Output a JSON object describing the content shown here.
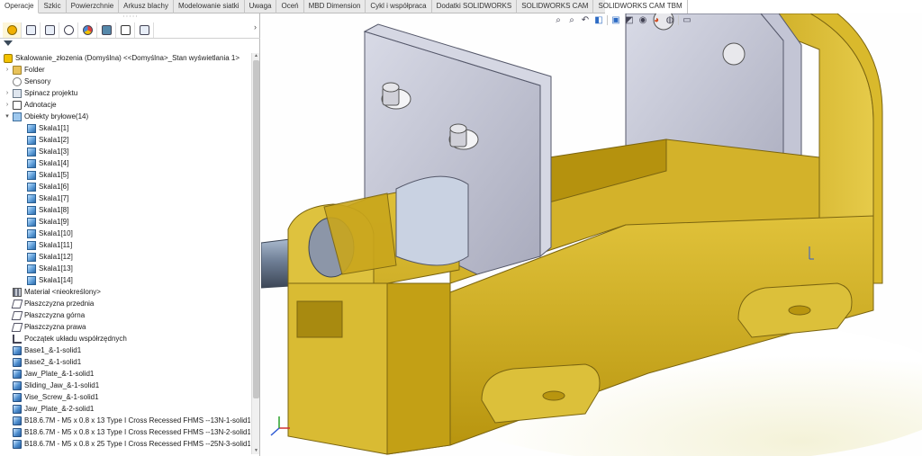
{
  "tabs": [
    "Operacje",
    "Szkic",
    "Powierzchnie",
    "Arkusz blachy",
    "Modelowanie siatki",
    "Uwaga",
    "Oceń",
    "MBD Dimension",
    "Cykl i współpraca",
    "Dodatki SOLIDWORKS",
    "SOLIDWORKS CAM",
    "SOLIDWORKS CAM TBM"
  ],
  "active_tab": "Operacje",
  "panel_icons": [
    "feature-manager-icon",
    "property-manager-icon",
    "configuration-manager-icon",
    "dimxpert-icon",
    "display-manager-icon",
    "cam-feature-tree-icon",
    "cam-operation-tree-icon",
    "cam-tool-tree-icon"
  ],
  "tree": {
    "root": "Skalowanie_złozenia (Domyślna) <<Domyślna>_Stan wyświetlania 1>",
    "items": [
      {
        "label": "Folder",
        "icon": "folder-icon",
        "expandable": true
      },
      {
        "label": "Sensory",
        "icon": "sensor-icon",
        "expandable": false
      },
      {
        "label": "Spinacz projektu",
        "icon": "design-binder-icon",
        "expandable": true
      },
      {
        "label": "Adnotacje",
        "icon": "annotations-icon",
        "expandable": true
      },
      {
        "label": "Obiekty bryłowe(14)",
        "icon": "solid-bodies-icon",
        "expandable": true
      }
    ],
    "bodies": [
      "Skala1[1]",
      "Skala1[2]",
      "Skala1[3]",
      "Skala1[4]",
      "Skala1[5]",
      "Skala1[6]",
      "Skala1[7]",
      "Skala1[8]",
      "Skala1[9]",
      "Skala1[10]",
      "Skala1[11]",
      "Skala1[12]",
      "Skala1[13]",
      "Skala1[14]"
    ],
    "after": [
      {
        "label": "Materiał <nieokreślony>",
        "icon": "material-icon"
      },
      {
        "label": "Płaszczyzna przednia",
        "icon": "plane-icon"
      },
      {
        "label": "Płaszczyzna górna",
        "icon": "plane-icon"
      },
      {
        "label": "Płaszczyzna prawa",
        "icon": "plane-icon"
      },
      {
        "label": "Początek układu współrzędnych",
        "icon": "origin-icon"
      }
    ],
    "parts": [
      "Base1_&-1-solid1",
      "Base2_&-1-solid1",
      "Jaw_Plate_&-1-solid1",
      "Sliding_Jaw_&-1-solid1",
      "Vise_Screw_&-1-solid1",
      "Jaw_Plate_&-2-solid1",
      "B18.6.7M - M5 x 0.8 x 13 Type I Cross Recessed FHMS --13N-1-solid1",
      "B18.6.7M - M5 x 0.8 x 13 Type I Cross Recessed FHMS --13N-2-solid1",
      "B18.6.7M - M5 x 0.8 x 25 Type I Cross Recessed FHMS --25N-3-solid1"
    ]
  },
  "colors": {
    "base_yellow": "#c9a61c",
    "plate_gray": "#b9bccd",
    "screw_blue": "#9ec3e6",
    "accent": "#2d6bc4"
  }
}
